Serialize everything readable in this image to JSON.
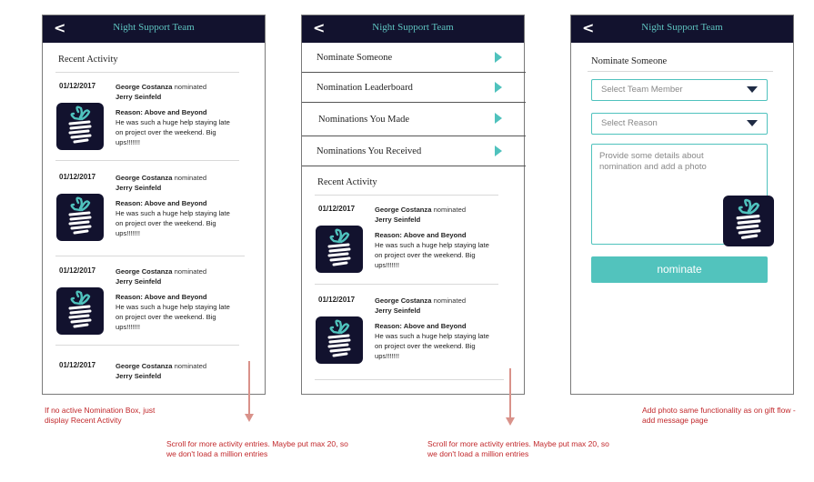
{
  "header": {
    "back_glyph": "<",
    "title": "Night Support Team"
  },
  "screen1": {
    "section_title": "Recent Activity",
    "entries": [
      {
        "date": "01/12/2017",
        "nominator": "George Costanza",
        "verb": "nominated",
        "nominee": "Jerry Seinfeld",
        "reason_title": "Reason: Above and Beyond",
        "reason_text": "He was such a huge help staying late on project over the weekend. Big ups!!!!!!!"
      },
      {
        "date": "01/12/2017",
        "nominator": "George Costanza",
        "verb": "nominated",
        "nominee": "Jerry Seinfeld",
        "reason_title": "Reason: Above and Beyond",
        "reason_text": "He was such a huge help staying late on project over the weekend. Big ups!!!!!!!"
      },
      {
        "date": "01/12/2017",
        "nominator": "George Costanza",
        "verb": "nominated",
        "nominee": "Jerry Seinfeld",
        "reason_title": "Reason: Above and Beyond",
        "reason_text": "He was such a huge help staying late on project over the weekend. Big ups!!!!!!!"
      },
      {
        "date": "01/12/2017",
        "nominator": "George Costanza",
        "verb": "nominated",
        "nominee": "Jerry Seinfeld"
      }
    ]
  },
  "screen2": {
    "menu": [
      "Nominate Someone",
      "Nomination Leaderboard",
      "Nominations You Made",
      "Nominations You Received"
    ],
    "section_title": "Recent Activity",
    "entries": [
      {
        "date": "01/12/2017",
        "nominator": "George Costanza",
        "verb": "nominated",
        "nominee": "Jerry Seinfeld",
        "reason_title": "Reason: Above and Beyond",
        "reason_text": "He was such a huge help staying late on project over the weekend. Big ups!!!!!!!"
      },
      {
        "date": "01/12/2017",
        "nominator": "George Costanza",
        "verb": "nominated",
        "nominee": "Jerry Seinfeld",
        "reason_title": "Reason: Above and Beyond",
        "reason_text": "He was such a huge help staying late on project over the weekend. Big ups!!!!!!!"
      }
    ]
  },
  "screen3": {
    "section_title": "Nominate Someone",
    "team_member_placeholder": "Select Team Member",
    "reason_placeholder": "Select Reason",
    "details_placeholder": "Provide some details about nomination and add a photo",
    "submit_label": "nominate"
  },
  "notes": {
    "no_box": "If no active Nomination Box, just display Recent Activity",
    "scroll1": "Scroll for more activity entries. Maybe put max 20, so we don't load a million entries",
    "scroll2": "Scroll for more activity entries. Maybe put max 20, so we don't load a million entries",
    "photo": "Add photo same functionality as on gift flow - add message page"
  },
  "colors": {
    "navy": "#12122e",
    "teal": "#4fc2bd",
    "note_red": "#c1282b",
    "arrow": "#d9928a"
  },
  "icons": {
    "back": "chevron-left-icon",
    "menu_arrow": "triangle-right-icon",
    "dropdown": "caret-down-icon",
    "logo": "gift-logo-icon"
  }
}
